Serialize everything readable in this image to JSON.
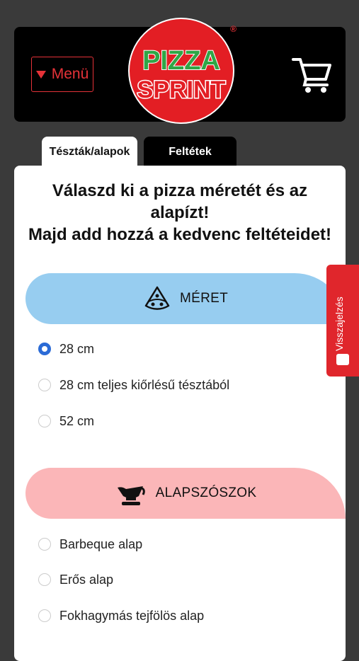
{
  "header": {
    "menu_label": "Menü",
    "logo_line1": "PIZZA",
    "logo_line2": "SPRINT",
    "logo_reg": "®",
    "colors": {
      "accent": "#e53238",
      "background": "#000000"
    }
  },
  "tabs": [
    {
      "label": "Tészták/alapok",
      "active": true
    },
    {
      "label": "Feltétek",
      "active": false
    }
  ],
  "main": {
    "heading_line1": "Válaszd ki a pizza méretét és az",
    "heading_line2": "alapízt!",
    "heading_line3": "Majd add hozzá a kedvenc feltéteidet!"
  },
  "size_section": {
    "title": "MÉRET",
    "icon": "pizza-slice-icon",
    "color": "#97cdf0",
    "options": [
      {
        "label": "28 cm",
        "selected": true
      },
      {
        "label": "28 cm teljes kiőrlésű tésztából",
        "selected": false
      },
      {
        "label": "52 cm",
        "selected": false
      }
    ]
  },
  "sauce_section": {
    "title": "ALAPSZÓSZOK",
    "icon": "sauce-boat-icon",
    "color": "#fbb6b8",
    "options": [
      {
        "label": "Barbeque alap",
        "selected": false
      },
      {
        "label": "Erős alap",
        "selected": false
      },
      {
        "label": "Fokhagymás tejfölös alap",
        "selected": false
      }
    ]
  },
  "feedback": {
    "label": "Visszajelzés",
    "color": "#e0262c"
  }
}
